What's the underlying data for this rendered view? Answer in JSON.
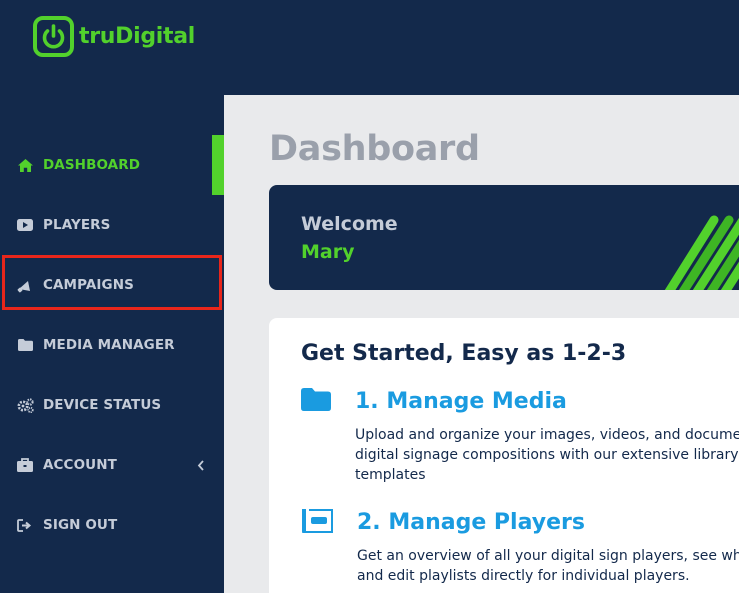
{
  "brand": {
    "name": "truDigital",
    "accent": "#52d12c",
    "navy": "#13294b",
    "blue": "#1a9be0"
  },
  "sidebar": {
    "items": [
      {
        "label": "DASHBOARD",
        "icon": "home-icon",
        "active": true
      },
      {
        "label": "PLAYERS",
        "icon": "play-icon"
      },
      {
        "label": "CAMPAIGNS",
        "icon": "megaphone-icon"
      },
      {
        "label": "MEDIA MANAGER",
        "icon": "folder-icon"
      },
      {
        "label": "DEVICE STATUS",
        "icon": "gears-icon"
      },
      {
        "label": "ACCOUNT",
        "icon": "briefcase-icon",
        "has_submenu": true
      },
      {
        "label": "SIGN OUT",
        "icon": "sign-out-icon"
      }
    ]
  },
  "main": {
    "title": "Dashboard",
    "welcome": {
      "label": "Welcome",
      "name": "Mary"
    },
    "get_started": {
      "title": "Get Started, Easy as 1-2-3",
      "steps": [
        {
          "title": "1. Manage Media",
          "icon": "folder-icon",
          "description": "Upload and organize your images, videos, and docume digital signage compositions with our extensive library templates"
        },
        {
          "title": "2. Manage Players",
          "icon": "player-icon",
          "description": "Get an overview of all your digital sign players, see who and edit playlists directly for individual players."
        }
      ]
    }
  }
}
